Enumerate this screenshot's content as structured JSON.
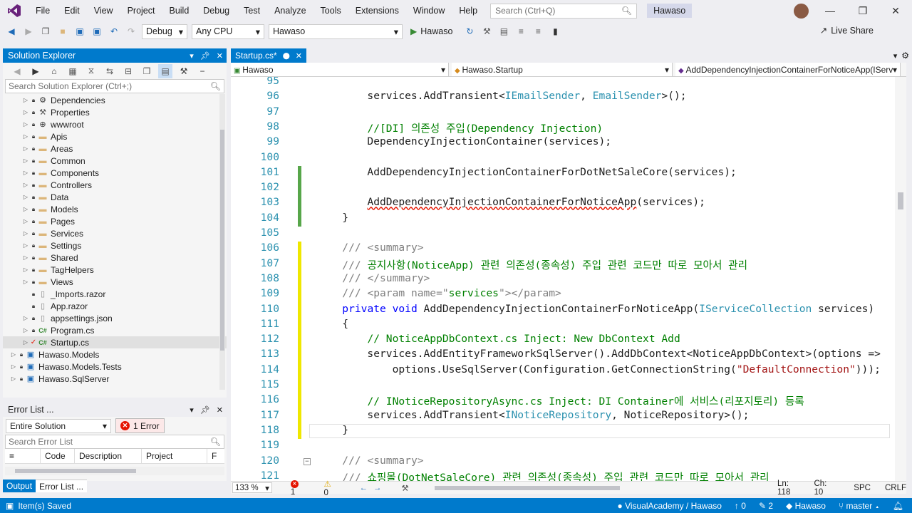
{
  "menubar": {
    "items": [
      "File",
      "Edit",
      "View",
      "Project",
      "Build",
      "Debug",
      "Test",
      "Analyze",
      "Tools",
      "Extensions",
      "Window",
      "Help"
    ],
    "search_placeholder": "Search (Ctrl+Q)",
    "solution_title": "Hawaso"
  },
  "toolbar": {
    "config": "Debug",
    "platform": "Any CPU",
    "startup_project": "Hawaso",
    "run_label": "Hawaso",
    "live_share": "Live Share"
  },
  "solution_explorer": {
    "title": "Solution Explorer",
    "search_placeholder": "Search Solution Explorer (Ctrl+;)",
    "items": [
      {
        "label": "Dependencies",
        "icon": "dependencies-icon",
        "level": 2,
        "arrow": true
      },
      {
        "label": "Properties",
        "icon": "wrench-icon",
        "level": 2,
        "arrow": true
      },
      {
        "label": "wwwroot",
        "icon": "globe-icon",
        "level": 2,
        "arrow": true
      },
      {
        "label": "Apis",
        "icon": "folder-icon",
        "level": 2,
        "arrow": true
      },
      {
        "label": "Areas",
        "icon": "folder-icon",
        "level": 2,
        "arrow": true
      },
      {
        "label": "Common",
        "icon": "folder-icon",
        "level": 2,
        "arrow": true
      },
      {
        "label": "Components",
        "icon": "folder-icon",
        "level": 2,
        "arrow": true
      },
      {
        "label": "Controllers",
        "icon": "folder-icon",
        "level": 2,
        "arrow": true
      },
      {
        "label": "Data",
        "icon": "folder-icon",
        "level": 2,
        "arrow": true
      },
      {
        "label": "Models",
        "icon": "folder-icon",
        "level": 2,
        "arrow": true
      },
      {
        "label": "Pages",
        "icon": "folder-icon",
        "level": 2,
        "arrow": true
      },
      {
        "label": "Services",
        "icon": "folder-icon",
        "level": 2,
        "arrow": true
      },
      {
        "label": "Settings",
        "icon": "folder-icon",
        "level": 2,
        "arrow": true
      },
      {
        "label": "Shared",
        "icon": "folder-icon",
        "level": 2,
        "arrow": true
      },
      {
        "label": "TagHelpers",
        "icon": "folder-icon",
        "level": 2,
        "arrow": true
      },
      {
        "label": "Views",
        "icon": "folder-icon",
        "level": 2,
        "arrow": true
      },
      {
        "label": "_Imports.razor",
        "icon": "razor-file-icon",
        "level": 2,
        "arrow": false
      },
      {
        "label": "App.razor",
        "icon": "razor-file-icon",
        "level": 2,
        "arrow": false
      },
      {
        "label": "appsettings.json",
        "icon": "json-file-icon",
        "level": 2,
        "arrow": true
      },
      {
        "label": "Program.cs",
        "icon": "csharp-file-icon",
        "level": 2,
        "arrow": true
      },
      {
        "label": "Startup.cs",
        "icon": "csharp-file-icon",
        "level": 2,
        "arrow": true,
        "selected": true
      },
      {
        "label": "Hawaso.Models",
        "icon": "project-icon",
        "level": 1,
        "arrow": true
      },
      {
        "label": "Hawaso.Models.Tests",
        "icon": "project-icon",
        "level": 1,
        "arrow": true
      },
      {
        "label": "Hawaso.SqlServer",
        "icon": "project-icon",
        "level": 1,
        "arrow": true
      }
    ]
  },
  "error_list": {
    "title": "Error List ...",
    "scope": "Entire Solution",
    "error_count": "1 Error",
    "search_placeholder": "Search Error List",
    "columns": [
      "Code",
      "Description",
      "Project",
      "F"
    ]
  },
  "bottom_tabs": [
    "Output",
    "Error List ..."
  ],
  "editor": {
    "tab_label": "Startup.cs*",
    "nav_project": "Hawaso",
    "nav_class": "Hawaso.Startup",
    "nav_member": "AddDependencyInjectionContainerForNoticeApp(IServ",
    "lines": [
      {
        "n": "95",
        "html": ""
      },
      {
        "n": "96",
        "html": "            services.AddTransient&lt;<span class='ty'>IEmailSender</span>, <span class='ty'>EmailSender</span>&gt;();"
      },
      {
        "n": "97",
        "html": ""
      },
      {
        "n": "98",
        "html": "            <span class='cm'>//[DI] 의존성 주입(Dependency Injection)</span>"
      },
      {
        "n": "99",
        "html": "            DependencyInjectionContainer(services);"
      },
      {
        "n": "100",
        "html": ""
      },
      {
        "n": "101",
        "html": "            AddDependencyInjectionContainerForDotNetSaleCore(services);"
      },
      {
        "n": "102",
        "html": ""
      },
      {
        "n": "103",
        "html": "            <span class='squig'>AddDependencyInjectionContainerForNoticeApp</span>(services);"
      },
      {
        "n": "104",
        "html": "        }"
      },
      {
        "n": "105",
        "html": ""
      },
      {
        "n": "106",
        "html": "        <span class='gd'>/// &lt;summary&gt;</span>"
      },
      {
        "n": "107",
        "html": "        <span class='gd'>///</span><span class='cm'> 공지사항(NoticeApp) 관련 의존성(종속성) 주입 관련 코드만 따로 모아서 관리</span>"
      },
      {
        "n": "108",
        "html": "        <span class='gd'>/// &lt;/summary&gt;</span>"
      },
      {
        "n": "109",
        "html": "        <span class='gd'>/// &lt;param name=\"</span><span class='cm'>services</span><span class='gd'>\"&gt;&lt;/param&gt;</span>"
      },
      {
        "n": "110",
        "html": "        <span class='kw'>private</span> <span class='kw'>void</span> AddDependencyInjectionContainerForNoticeApp(<span class='ty'>IServiceCollection</span> services)"
      },
      {
        "n": "111",
        "html": "        {"
      },
      {
        "n": "112",
        "html": "            <span class='cm'>// NoticeAppDbContext.cs Inject: New DbContext Add</span>"
      },
      {
        "n": "113",
        "html": "            services.AddEntityFrameworkSqlServer().AddDbContext&lt;NoticeAppDbContext&gt;(options =&gt;"
      },
      {
        "n": "114",
        "html": "                options.UseSqlServer(Configuration.GetConnectionString(<span class='str'>\"DefaultConnection\"</span>)));"
      },
      {
        "n": "115",
        "html": ""
      },
      {
        "n": "116",
        "html": "            <span class='cm'>// INoticeRepositoryAsync.cs Inject: DI Container에 서비스(리포지토리) 등록</span>"
      },
      {
        "n": "117",
        "html": "            services.AddTransient&lt;<span class='ty'>INoticeRepository</span>, NoticeRepository&gt;();"
      },
      {
        "n": "118",
        "html": "        }"
      },
      {
        "n": "119",
        "html": ""
      },
      {
        "n": "120",
        "html": "        <span class='gd'>/// &lt;summary&gt;</span>"
      },
      {
        "n": "121",
        "html": "        <span class='gd'>///</span><span class='cm'> 쇼핑몰(DotNetSaleCore) 관련 의존성(종속성) 주입 관련 코드만 따로 모아서 관리</span>"
      }
    ]
  },
  "editor_status": {
    "zoom": "133 %",
    "errors": "1",
    "warnings": "0",
    "line": "Ln: 118",
    "col": "Ch: 10",
    "whitespace": "SPC",
    "line_ending": "CRLF"
  },
  "statusbar": {
    "message": "Item(s) Saved",
    "repo": "VisualAcademy / Hawaso",
    "up_count": "0",
    "changes": "2",
    "project": "Hawaso",
    "branch": "master"
  },
  "colors": {
    "accent": "#007acc",
    "keyword": "#0000ff",
    "type": "#2b91af",
    "comment": "#008000"
  }
}
